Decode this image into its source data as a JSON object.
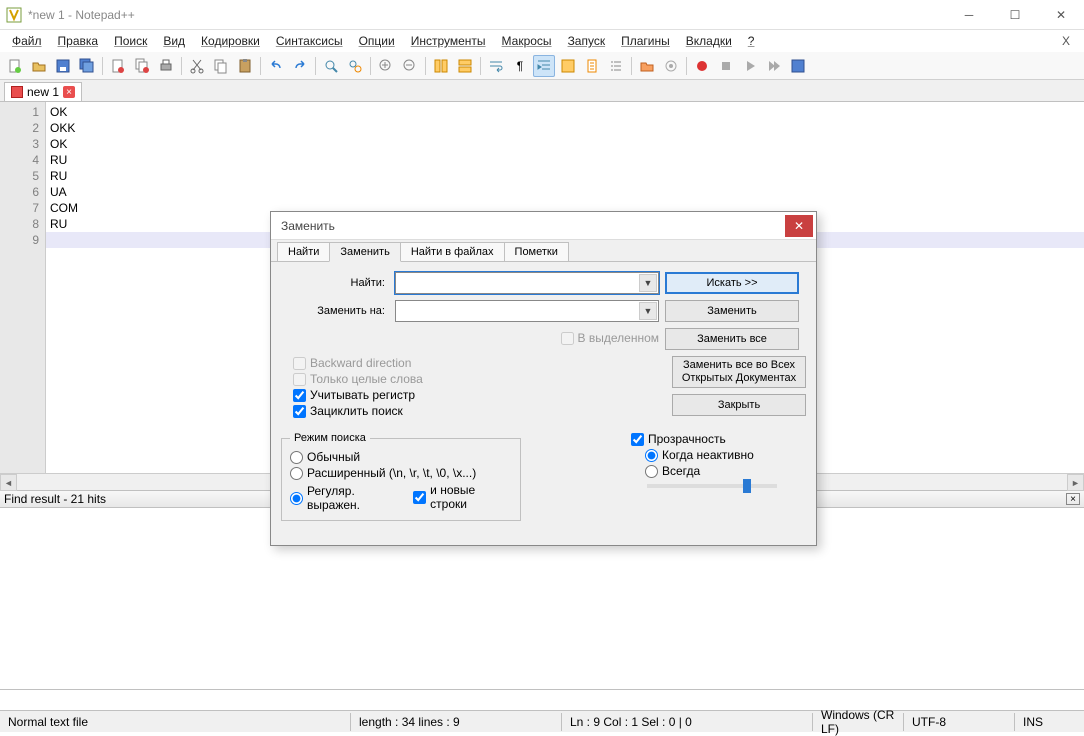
{
  "window": {
    "title": "*new 1 - Notepad++"
  },
  "menu": {
    "items": [
      "Файл",
      "Правка",
      "Поиск",
      "Вид",
      "Кодировки",
      "Синтаксисы",
      "Опции",
      "Инструменты",
      "Макросы",
      "Запуск",
      "Плагины",
      "Вкладки",
      "?"
    ]
  },
  "tabs": {
    "doc1": "new 1"
  },
  "editor": {
    "lines": [
      "OK",
      "OKK",
      "OK",
      "RU",
      "RU",
      "UA",
      "COM",
      "RU",
      ""
    ],
    "line_numbers": [
      "1",
      "2",
      "3",
      "4",
      "5",
      "6",
      "7",
      "8",
      "9"
    ]
  },
  "find_result": {
    "label": "Find result - 21 hits"
  },
  "statusbar": {
    "filetype": "Normal text file",
    "length": "length : 34    lines : 9",
    "pos": "Ln : 9    Col : 1    Sel : 0 | 0",
    "eol": "Windows (CR LF)",
    "encoding": "UTF-8",
    "ins": "INS"
  },
  "dialog": {
    "title": "Заменить",
    "tabs": {
      "find": "Найти",
      "replace": "Заменить",
      "find_in_files": "Найти в файлах",
      "marks": "Пометки"
    },
    "labels": {
      "find": "Найти:",
      "replace_with": "Заменить на:"
    },
    "buttons": {
      "search": "Искать >>",
      "replace": "Заменить",
      "replace_all": "Заменить все",
      "replace_all_open": "Заменить все во Всех Открытых Документах",
      "close": "Закрыть"
    },
    "checks": {
      "in_selection": "В выделенном",
      "backward": "Backward direction",
      "whole_word": "Только целые слова",
      "match_case": "Учитывать регистр",
      "wrap": "Зациклить поиск",
      "dot_newline": "и новые строки"
    },
    "search_mode": {
      "legend": "Режим поиска",
      "normal": "Обычный",
      "extended": "Расширенный (\\n, \\r, \\t, \\0, \\x...)",
      "regex": "Регуляр. выражен."
    },
    "transparency": {
      "label": "Прозрачность",
      "on_lose_focus": "Когда неактивно",
      "always": "Всегда"
    }
  }
}
